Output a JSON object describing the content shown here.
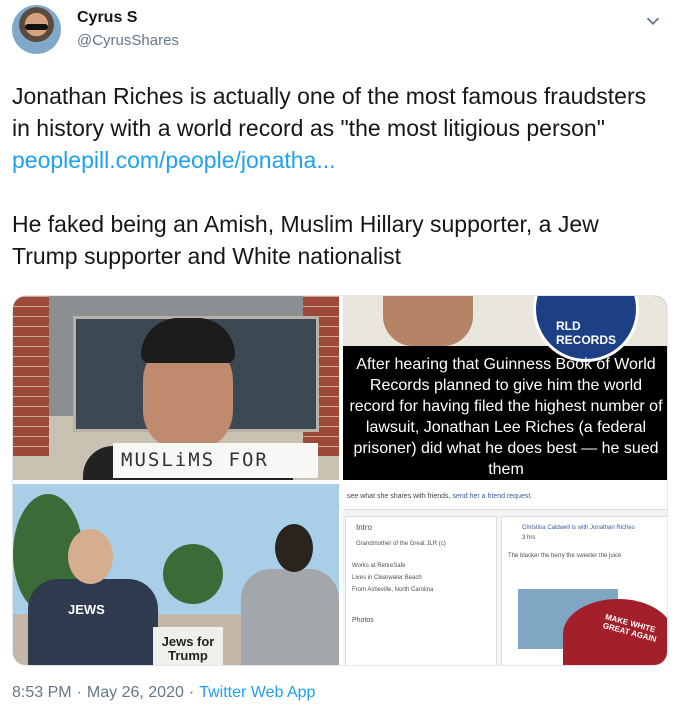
{
  "author": {
    "name": "Cyrus S",
    "handle": "@CyrusShares"
  },
  "tweet": {
    "paragraph1_text": "Jonathan Riches is actually one of the most famous fraudsters in history with a world record as \"the most litigious person\" ",
    "paragraph1_link": "peoplepill.com/people/jonatha...",
    "paragraph2": "He faked being an Amish, Muslim Hillary supporter, a Jew Trump supporter and White nationalist"
  },
  "media": {
    "img1_sign": "MUSLiMS FOR",
    "img2_text": "After hearing that Guinness Book of World Records planned to give him the world record for having filed the highest number of lawsuit, Jonathan Lee Riches (a federal prisoner) did what he does best — he sued them",
    "img2_seal": "RLD RECORDS",
    "img3_shirt": "JEWS",
    "img3_sign": "Jews for Trump",
    "img4_bar_text": "see what she shares with friends, ",
    "img4_bar_link": "send her a friend request.",
    "img4_intro": "Intro",
    "img4_grandmother": "Grandmother of the Great JLR (c)",
    "img4_works": "Works at RetireSafe",
    "img4_lives": "Lives in Clearwater Beach",
    "img4_from": "From Asheville, North Carolina",
    "img4_photos": "Photos",
    "img4_post_author": "Christina Caldwell is with Jonathan Riches",
    "img4_post_time": "3 hrs",
    "img4_post_text": "The blacker the berry the sweeter the juice",
    "img4_hat": "MAKE WHITE GREAT AGAIN"
  },
  "footer": {
    "time": "8:53 PM",
    "date": "May 26, 2020",
    "app": "Twitter Web App"
  },
  "colors": {
    "link": "#1da1f2",
    "meta": "#657786",
    "text": "#14171a"
  }
}
